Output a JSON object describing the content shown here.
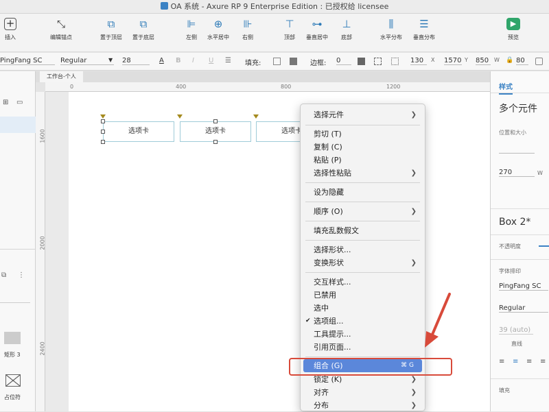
{
  "window": {
    "title": "OA 系统 - Axure RP 9 Enterprise Edition : 已授权给 licensee"
  },
  "toolbar": {
    "insert": "插入",
    "edit_anchor": "编辑锚点",
    "bring_front": "置于顶层",
    "send_back": "置于底层",
    "left": "左侧",
    "h_center": "水平居中",
    "right": "右侧",
    "top": "顶部",
    "v_center": "垂直居中",
    "bottom": "底部",
    "h_distribute": "水平分布",
    "v_distribute": "垂直分布",
    "preview": "预览"
  },
  "format": {
    "font": "PingFang SC",
    "weight": "Regular",
    "size": "28",
    "fill_label": "填充:",
    "border_label": "边框:",
    "border_value": "0",
    "x": "130",
    "x_label": "X",
    "y": "1570",
    "y_label": "Y",
    "w": "850",
    "w_label": "W",
    "h": "80"
  },
  "canvas": {
    "tab": "工作台-个人",
    "ruler_h": [
      "0",
      "400",
      "800",
      "1200"
    ],
    "ruler_v": [
      "1600",
      "2000",
      "2400"
    ],
    "widgets": [
      "选项卡",
      "选项卡",
      "选项卡"
    ]
  },
  "left_panel": {
    "shape_label": "矩形 3",
    "placeholder_label": "占位符"
  },
  "right_panel": {
    "tab": "样式",
    "heading": "多个元件",
    "pos_size": "位置和大小",
    "width": "270",
    "w_tag": "W",
    "name": "Box 2*",
    "opacity": "不透明度",
    "typography": "字体排印",
    "font": "PingFang SC",
    "weight": "Regular",
    "line_height": "39 (auto)",
    "line_height_label": "直线",
    "fill": "填充"
  },
  "menu": {
    "select_widgets": "选择元件",
    "cut": "剪切 (T)",
    "copy": "复制 (C)",
    "paste": "粘贴 (P)",
    "paste_special": "选择性粘贴",
    "hide": "设为隐藏",
    "order": "顺序 (O)",
    "lorem": "填充乱数假文",
    "select_shape": "选择形状...",
    "transform_shape": "变换形状",
    "interaction_styles": "交互样式...",
    "disabled": "已禁用",
    "selected": "选中",
    "selection_group": "选项组...",
    "tooltip": "工具提示...",
    "ref_page": "引用页面...",
    "group": "组合 (G)",
    "group_shortcut": "⌘ G",
    "lock": "锁定 (K)",
    "align": "对齐",
    "distribute": "分布"
  },
  "colors": {
    "highlight": "#5b87da",
    "annotation": "#d84a3a",
    "accent": "#2e7bb8"
  }
}
